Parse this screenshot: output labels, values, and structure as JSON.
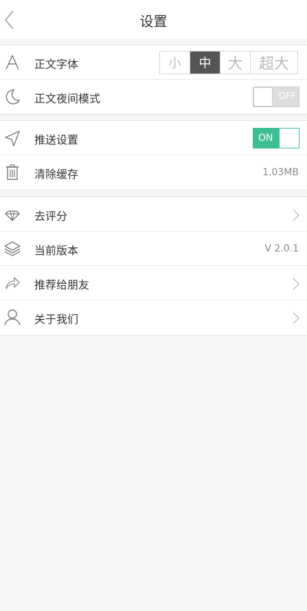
{
  "header": {
    "title": "设置",
    "back_icon": "chevron-left-icon"
  },
  "groups": [
    {
      "items": [
        {
          "label": "正文字体",
          "icon": "font-icon",
          "font_sizes": [
            "小",
            "中",
            "大",
            "超大"
          ],
          "selected": "中"
        },
        {
          "label": "正文夜间模式",
          "icon": "moon-icon",
          "toggle": "OFF"
        }
      ]
    },
    {
      "items": [
        {
          "label": "推送设置",
          "icon": "send-icon",
          "toggle": "ON"
        },
        {
          "label": "清除缓存",
          "icon": "trash-icon",
          "value": "1.03MB"
        }
      ]
    },
    {
      "items": [
        {
          "label": "去评分",
          "icon": "diamond-icon"
        },
        {
          "label": "当前版本",
          "icon": "layers-icon",
          "value": "V 2.0.1"
        },
        {
          "label": "推荐给朋友",
          "icon": "share-icon"
        },
        {
          "label": "关于我们",
          "icon": "user-icon"
        }
      ]
    }
  ],
  "colors": {
    "toggle_on": "#3dbf95",
    "selected_segment": "#555555"
  }
}
